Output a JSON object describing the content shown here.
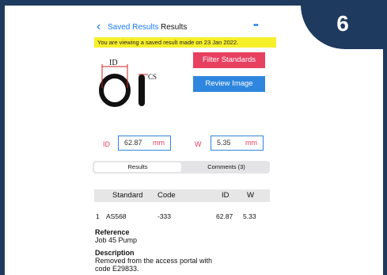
{
  "badge": "6",
  "nav": {
    "back_label": "Saved Results",
    "title": "Results",
    "more": "••"
  },
  "banner": "You are viewing a saved result made on 23 Jan 2022.",
  "buttons": {
    "filter": "Filter Standards",
    "review": "Review Image"
  },
  "diagram": {
    "id_label": "ID",
    "cs_label": "CS"
  },
  "id_field": {
    "label": "ID",
    "value": "62.87",
    "unit": "mm"
  },
  "w_field": {
    "label": "W",
    "value": "5.35",
    "unit": "mm"
  },
  "tabs": {
    "results": "Results",
    "comments": "Comments (3)"
  },
  "table": {
    "headers": [
      "Standard",
      "Code",
      "ID",
      "W"
    ],
    "rows": [
      {
        "index": "1",
        "standard": "AS568",
        "code": "-333",
        "id": "62.87",
        "w": "5.33"
      }
    ]
  },
  "reference": {
    "title": "Reference",
    "text": "Job 45  Pump"
  },
  "description": {
    "title": "Description",
    "line1": "Removed from the access portal with",
    "line2": "code E29833."
  },
  "colors": {
    "frame": "#1f3a5f",
    "accent_blue": "#1a7cf5",
    "filter_btn": "#e84060",
    "review_btn": "#2e86de",
    "banner": "#f7ef2a"
  }
}
